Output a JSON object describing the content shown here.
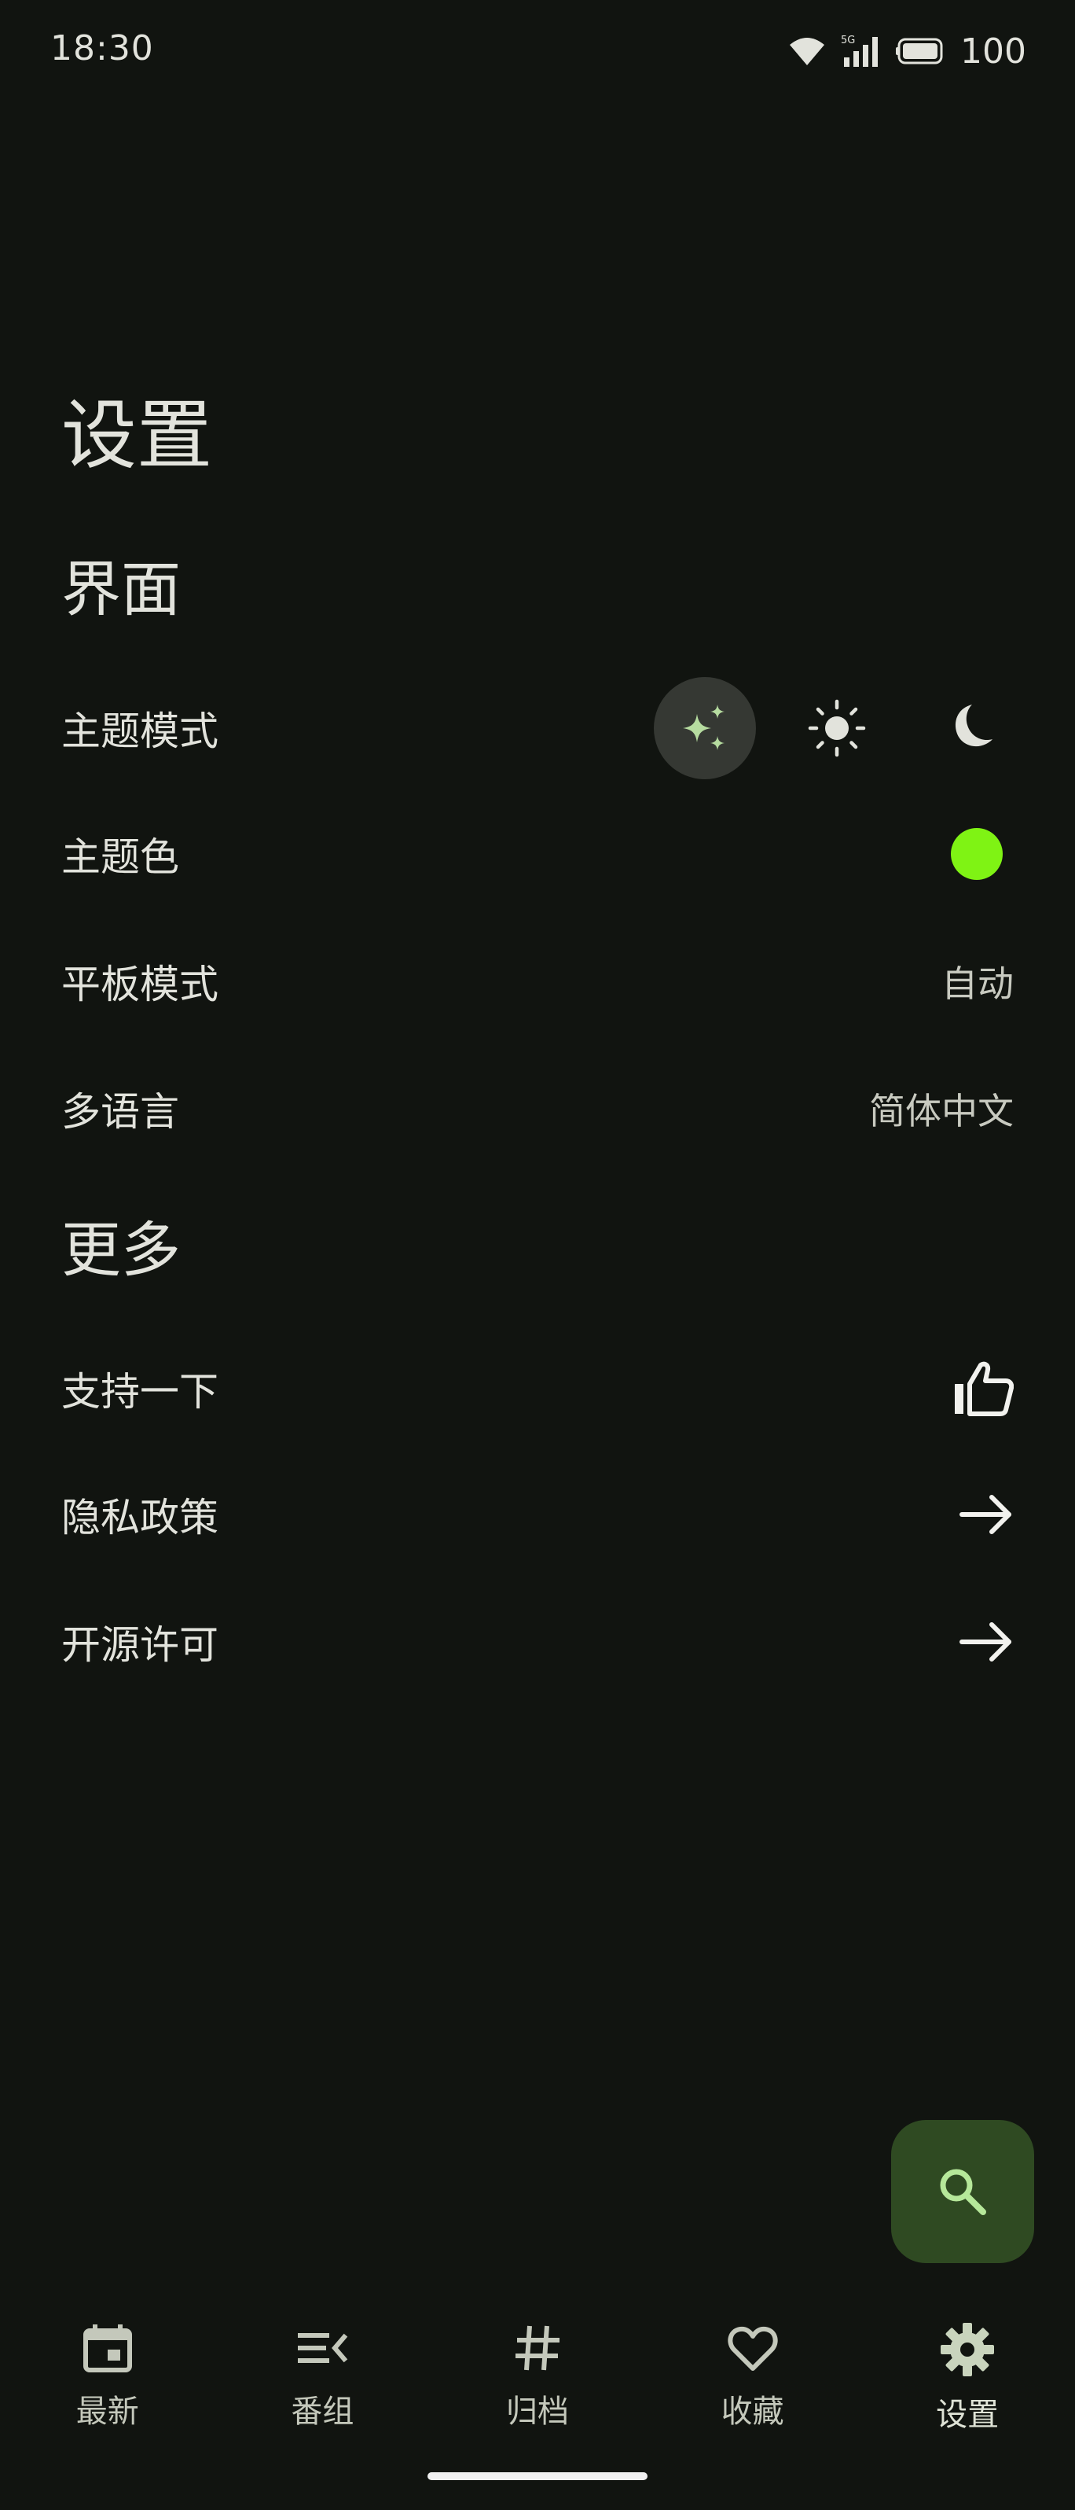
{
  "status_bar": {
    "time": "18:30",
    "network": "5G",
    "battery": "100",
    "icons": [
      "wifi-icon",
      "cellular-5g-icon",
      "battery-icon"
    ]
  },
  "page": {
    "title": "设置"
  },
  "sections": {
    "ui": {
      "title": "界面",
      "theme_mode": {
        "label": "主题模式",
        "options": [
          "auto-sparkle-icon",
          "light-sun-icon",
          "dark-moon-icon"
        ],
        "selected": "auto-sparkle-icon"
      },
      "theme_color": {
        "label": "主题色",
        "color": "#7ff314"
      },
      "tablet_mode": {
        "label": "平板模式",
        "value": "自动"
      },
      "language": {
        "label": "多语言",
        "value": "简体中文"
      }
    },
    "more": {
      "title": "更多",
      "support": {
        "label": "支持一下",
        "icon": "thumb-up-icon"
      },
      "privacy": {
        "label": "隐私政策",
        "icon": "arrow-right-icon"
      },
      "license": {
        "label": "开源许可",
        "icon": "arrow-right-icon"
      }
    }
  },
  "fab": {
    "icon": "search-icon",
    "background": "#2f4a22",
    "icon_color": "#b6e89a"
  },
  "bottom_nav": {
    "items": [
      {
        "label": "最新",
        "icon": "calendar-icon"
      },
      {
        "label": "番组",
        "icon": "list-icon"
      },
      {
        "label": "归档",
        "icon": "hashtag-icon"
      },
      {
        "label": "收藏",
        "icon": "heart-icon"
      },
      {
        "label": "设置",
        "icon": "gear-icon"
      }
    ],
    "active_index": 4
  },
  "colors": {
    "background": "#111410",
    "text": "#e2e3dc",
    "accent": "#7ff314",
    "selected_chip": "#353833"
  }
}
